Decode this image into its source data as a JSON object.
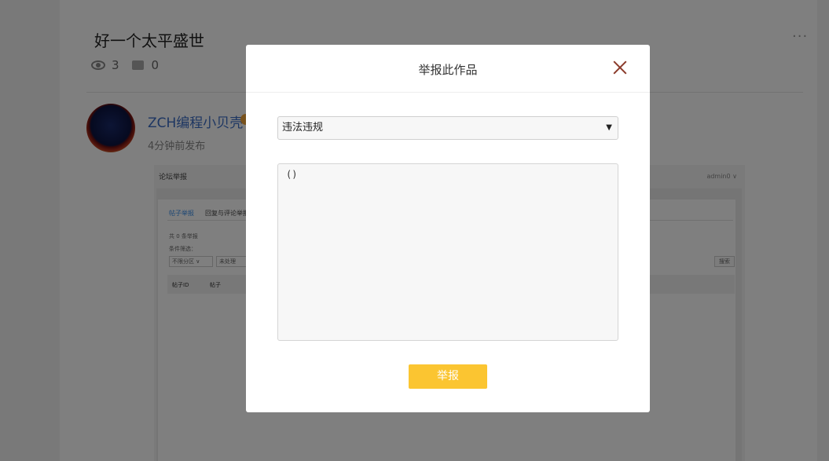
{
  "post": {
    "title": "好一个太平盛世",
    "more": "···",
    "views": "3",
    "comments": "0",
    "author": "ZCH编程小贝壳",
    "time": "4分钟前发布"
  },
  "embed": {
    "title": "论坛举报",
    "user": "admin0 ∨",
    "tab_post": "帖子举报",
    "tab_reply": "回复与评论举报",
    "count": "共 0 条举报",
    "filter_label": "条件筛选：",
    "select_1": "不限分区 ∨",
    "select_2": "未处理",
    "search": "搜索",
    "col_id": "帖子ID",
    "col_post": "帖子"
  },
  "modal": {
    "title": "举报此作品",
    "reason_selected": "违法违规",
    "reason_arrow": "▼",
    "detail_text": "()",
    "submit_label": "举报"
  },
  "colors": {
    "submit": "#fbc531",
    "close": "#8b3a2a",
    "author": "#3b6cc5"
  }
}
